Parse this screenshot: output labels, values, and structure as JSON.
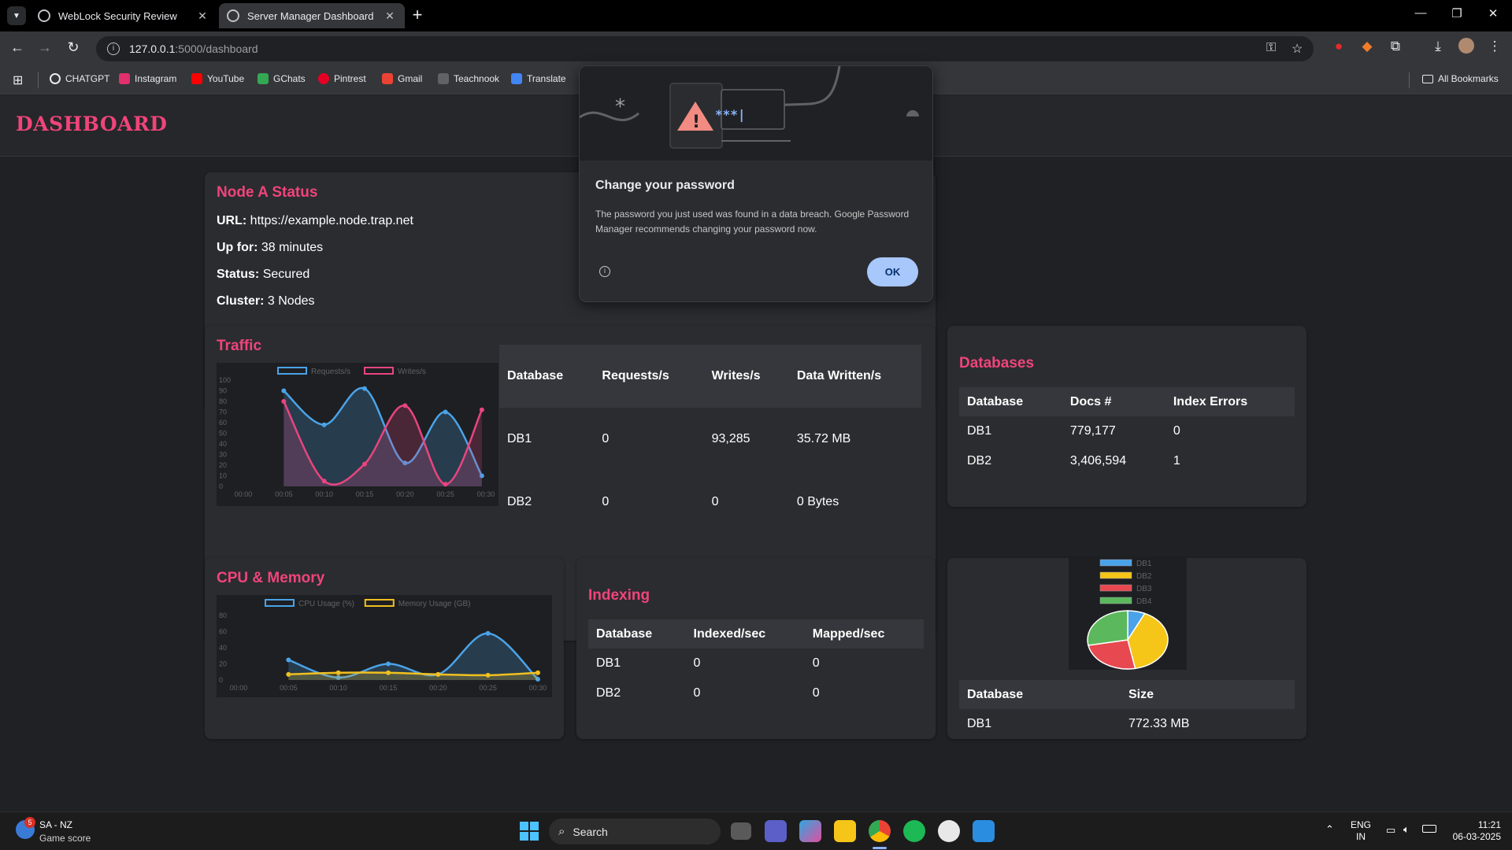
{
  "browser": {
    "tabs": [
      {
        "title": "WebLock Security Review",
        "active": false
      },
      {
        "title": "Server Manager Dashboard",
        "active": true
      }
    ],
    "url_host": "127.0.0.1",
    "url_path": ":5000/dashboard",
    "bookmarks": [
      {
        "label": "CHATGPT",
        "icon": "chatgpt-icon",
        "color": "#e8eaed"
      },
      {
        "label": "Instagram",
        "icon": "instagram-icon",
        "color": "#e1306c"
      },
      {
        "label": "YouTube",
        "icon": "youtube-icon",
        "color": "#ff0000"
      },
      {
        "label": "GChats",
        "icon": "gchat-icon",
        "color": "#34a853"
      },
      {
        "label": "Pintrest",
        "icon": "pinterest-icon",
        "color": "#e60023"
      },
      {
        "label": "Gmail",
        "icon": "gmail-icon",
        "color": "#ea4335"
      },
      {
        "label": "Teachnook",
        "icon": "teachnook-icon",
        "color": "#5f6368"
      },
      {
        "label": "Translate",
        "icon": "translate-icon",
        "color": "#4285f4"
      }
    ],
    "all_bookmarks": "All Bookmarks"
  },
  "dashboard": {
    "brand": "DASHBOARD",
    "node": {
      "title": "Node A Status",
      "lines": [
        {
          "label": "URL:",
          "value": "https://example.node.trap.net"
        },
        {
          "label": "Up for:",
          "value": "38 minutes"
        },
        {
          "label": "Status:",
          "value": "Secured"
        },
        {
          "label": "Cluster:",
          "value": "3 Nodes"
        }
      ]
    },
    "traffic": {
      "title": "Traffic",
      "headers": [
        "Database",
        "Requests/s",
        "Writes/s",
        "Data Written/s"
      ],
      "rows": [
        [
          "DB1",
          "0",
          "93,285",
          "35.72 MB"
        ],
        [
          "DB2",
          "0",
          "0",
          "0 Bytes"
        ]
      ]
    },
    "databases": {
      "title": "Databases",
      "headers": [
        "Database",
        "Docs #",
        "Index Errors"
      ],
      "rows": [
        [
          "DB1",
          "779,177",
          "0"
        ],
        [
          "DB2",
          "3,406,594",
          "1"
        ]
      ]
    },
    "cpu": {
      "title": "CPU & Memory"
    },
    "indexing": {
      "title": "Indexing",
      "headers": [
        "Database",
        "Indexed/sec",
        "Mapped/sec"
      ],
      "rows": [
        [
          "DB1",
          "0",
          "0"
        ],
        [
          "DB2",
          "0",
          "0"
        ]
      ]
    },
    "size": {
      "headers": [
        "Database",
        "Size"
      ],
      "rows": [
        [
          "DB1",
          "772.33 MB"
        ]
      ]
    }
  },
  "chart_data": [
    {
      "type": "area",
      "chart": "traffic",
      "x": [
        "00:00",
        "00:05",
        "00:10",
        "00:15",
        "00:20",
        "00:25",
        "00:30"
      ],
      "ylim": [
        0,
        100
      ],
      "yticks": [
        0,
        10,
        20,
        30,
        40,
        50,
        60,
        70,
        80,
        90,
        100
      ],
      "series": [
        {
          "name": "Requests/s",
          "color": "#4aa3e8",
          "x": [
            5,
            10,
            15,
            20,
            25,
            29.5
          ],
          "values": [
            90,
            58,
            92,
            22,
            70,
            10
          ]
        },
        {
          "name": "Writes/s",
          "color": "#e8457f",
          "x": [
            5,
            10,
            15,
            20,
            25,
            29.5
          ],
          "values": [
            80,
            5,
            21,
            76,
            2,
            72
          ]
        }
      ]
    },
    {
      "type": "area",
      "chart": "cpu",
      "x": [
        "00:00",
        "00:05",
        "00:10",
        "00:15",
        "00:20",
        "00:25",
        "00:30"
      ],
      "ylim": [
        0,
        90
      ],
      "yticks": [
        0,
        20,
        40,
        60,
        80
      ],
      "series": [
        {
          "name": "CPU Usage (%)",
          "color": "#4aa3e8",
          "x": [
            5,
            10,
            15,
            20,
            25,
            30
          ],
          "values": [
            25,
            3,
            20,
            7,
            58,
            1
          ]
        },
        {
          "name": "Memory Usage (GB)",
          "color": "#f0c020",
          "x": [
            5,
            10,
            15,
            20,
            25,
            30
          ],
          "values": [
            7,
            9,
            9,
            7,
            6,
            9
          ]
        }
      ]
    },
    {
      "type": "pie",
      "chart": "storage",
      "legend": [
        "DB1",
        "DB2",
        "DB3",
        "DB4"
      ],
      "colors": [
        "#4aa3e8",
        "#f5c518",
        "#e8484f",
        "#5cb85c"
      ],
      "values": [
        7,
        40,
        25,
        28
      ]
    }
  ],
  "dialog": {
    "title": "Change your password",
    "body": "The password you just used was found in a data breach. Google Password Manager recommends changing your password now.",
    "ok": "OK",
    "hero_text": "***|"
  },
  "taskbar": {
    "widget_title": "SA - NZ",
    "widget_sub": "Game score",
    "widget_badge": "5",
    "search": "Search",
    "lang": "ENG",
    "region": "IN",
    "time": "11:21",
    "date": "06-03-2025"
  }
}
